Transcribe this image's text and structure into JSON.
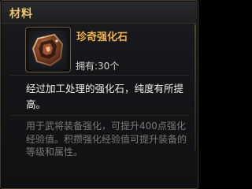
{
  "header": {
    "title": "材料"
  },
  "item": {
    "name": "珍奇强化石",
    "owned_text": "拥有:30个",
    "icon": "enhancement-stone-icon"
  },
  "description": "经过加工处理的强化石，纯度有所提高。",
  "usage": "用于武将装备强化，可提升400点强化经验值。积攒强化经验值可提升装备的等级和属性。",
  "colors": {
    "title": "#e7c26b",
    "item_name": "#f0b24a",
    "description": "#f1efe8",
    "usage": "#7b7a77"
  }
}
